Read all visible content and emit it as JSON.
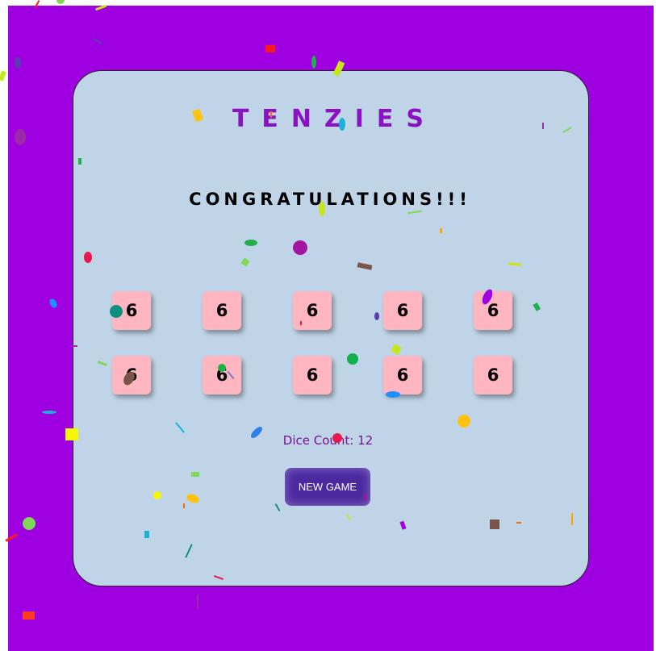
{
  "app": {
    "title": "TENZIES",
    "message": "CONGRATULATIONS!!!",
    "dice_count_text": "Dice Count: 12",
    "new_game_label": "NEW GAME"
  },
  "dice": [
    "6",
    "6",
    "6",
    "6",
    "6",
    "6",
    "6",
    "6",
    "6",
    "6"
  ],
  "colors": {
    "background": "#9e00e2",
    "card": "#c0d4e8",
    "title": "#8a12c2",
    "die": "#ffb6c1",
    "button": "#4b2aa0"
  }
}
